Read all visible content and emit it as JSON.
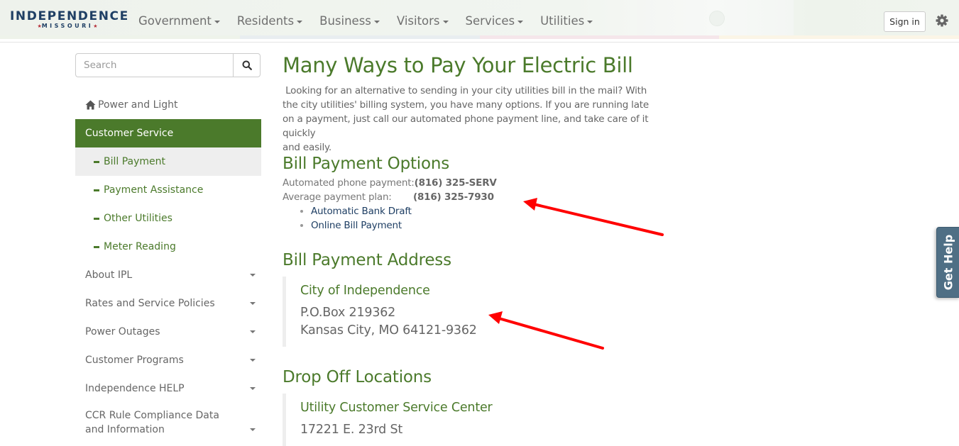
{
  "header": {
    "logo": {
      "line1": "INDEPENDENCE",
      "line2": "MISSOURI",
      "star": "★",
      "tm": "™"
    },
    "nav": [
      {
        "label": "Government"
      },
      {
        "label": "Residents"
      },
      {
        "label": "Business"
      },
      {
        "label": "Visitors"
      },
      {
        "label": "Services"
      },
      {
        "label": "Utilities"
      }
    ],
    "sign_in": "Sign in",
    "settings_icon": "gear-icon",
    "stripe_colors": [
      "#eef3ea",
      "#e8edf0",
      "#f5e6ea",
      "#fbf5e6"
    ]
  },
  "sidebar": {
    "search": {
      "placeholder": "Search",
      "value": "",
      "icon": "search-icon"
    },
    "items": [
      {
        "label": "Power and Light",
        "type": "root",
        "icon": "home-icon"
      },
      {
        "label": "Customer Service",
        "type": "active"
      },
      {
        "label": "Bill Payment",
        "type": "sub-current"
      },
      {
        "label": "Payment Assistance",
        "type": "sub"
      },
      {
        "label": "Other Utilities",
        "type": "sub"
      },
      {
        "label": "Meter Reading",
        "type": "sub"
      },
      {
        "label": "About IPL",
        "type": "collapsible"
      },
      {
        "label": "Rates and Service Policies",
        "type": "collapsible"
      },
      {
        "label": "Power Outages",
        "type": "collapsible"
      },
      {
        "label": "Customer Programs",
        "type": "collapsible"
      },
      {
        "label": "Independence HELP",
        "type": "collapsible"
      },
      {
        "label": "CCR Rule Compliance Data and Information",
        "type": "collapsible"
      }
    ]
  },
  "main": {
    "title": "Many Ways to Pay Your Electric Bill",
    "intro": [
      " Looking for an alternative to sending in your city utilities bill in the mail? With",
      "the city utilities' billing system, you have many options. If you are running late",
      "on a payment, just call our automated phone payment line, and take care of it quickly",
      "and easily."
    ],
    "options": {
      "heading": "Bill Payment Options",
      "rows": [
        {
          "label": "Automated phone payment:",
          "value": "(816) 325-SERV"
        },
        {
          "label": "Average payment plan:",
          "value": "(816) 325-7930"
        }
      ],
      "links": [
        "Automatic Bank Draft",
        "Online Bill Payment"
      ]
    },
    "address": {
      "heading": "Bill Payment Address",
      "name": "City of Independence",
      "lines": [
        "P.O.Box 219362",
        "Kansas City, MO 64121-9362"
      ]
    },
    "dropoff": {
      "heading": "Drop Off Locations",
      "name": "Utility Customer Service Center",
      "lines": [
        "17221 E. 23rd St"
      ]
    }
  },
  "get_help": "Get Help",
  "colors": {
    "brand_green": "#4b7a2b",
    "link_blue": "#1f3f64",
    "annotation_red": "#ff0000",
    "help_tab": "#4f6f85"
  }
}
